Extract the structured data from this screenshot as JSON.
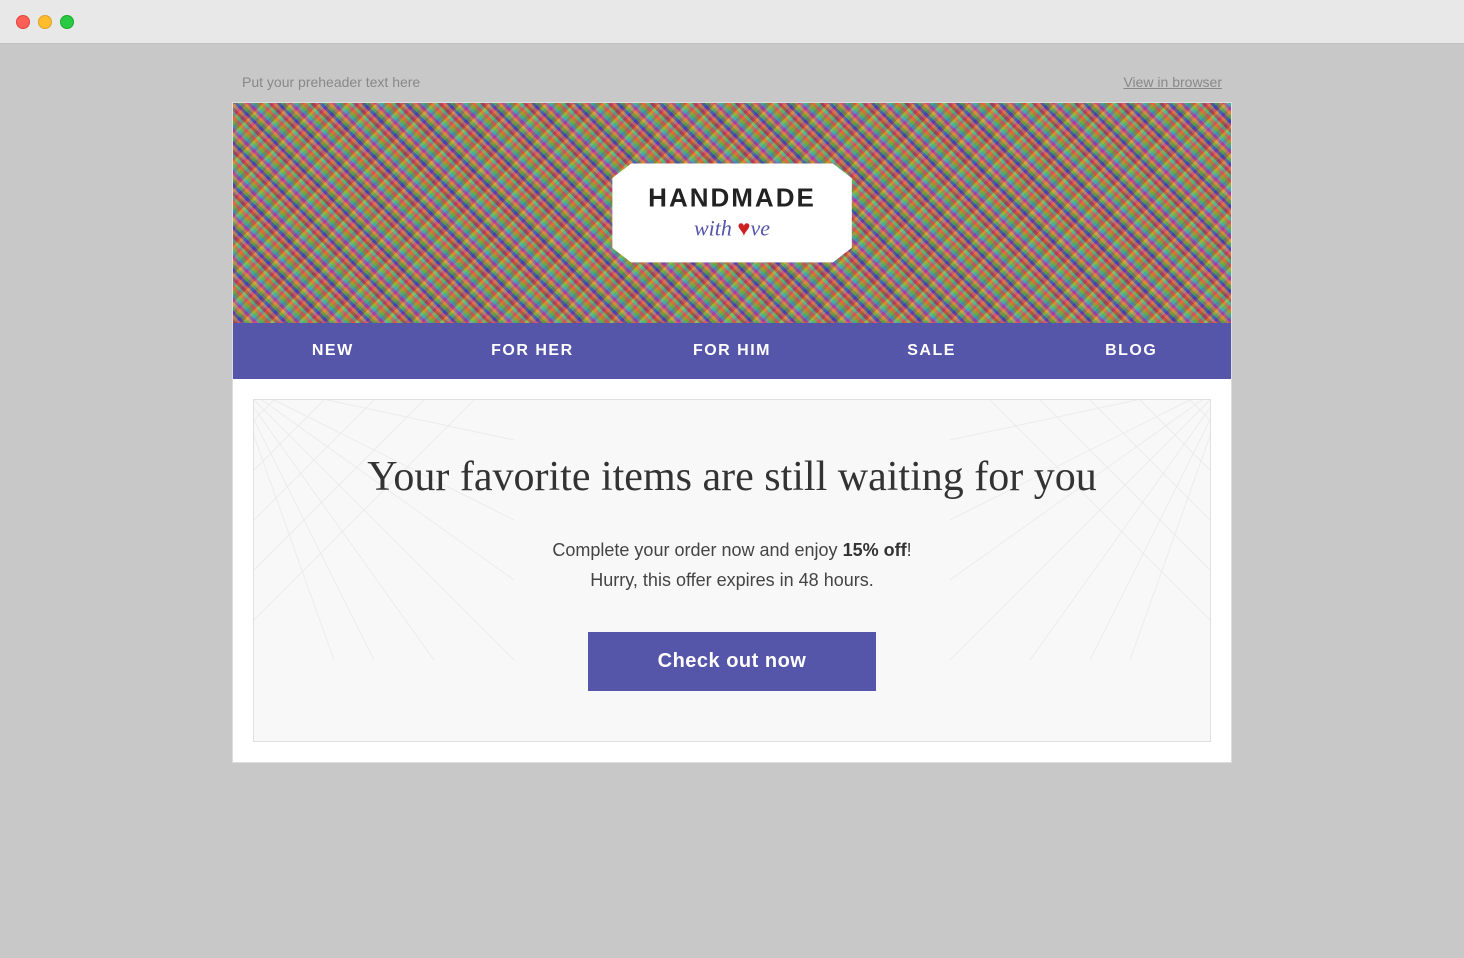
{
  "titlebar": {
    "traffic_lights": [
      "close",
      "minimize",
      "maximize"
    ]
  },
  "preheader": {
    "text": "Put your preheader text here",
    "view_in_browser": "View in browser"
  },
  "logo": {
    "title": "HANDMADE",
    "subtitle": "with love",
    "heart_char": "♥"
  },
  "nav": {
    "items": [
      {
        "label": "NEW"
      },
      {
        "label": "FOR HER"
      },
      {
        "label": "FOR HIM"
      },
      {
        "label": "SALE"
      },
      {
        "label": "BLOG"
      }
    ]
  },
  "hero": {
    "heading": "Your favorite items are still waiting for you",
    "subtext_prefix": "Complete your order now and enjoy ",
    "subtext_bold": "15% off",
    "subtext_suffix": "!",
    "subtext_line2": "Hurry, this offer expires in 48 hours.",
    "cta_label": "Check out now"
  }
}
